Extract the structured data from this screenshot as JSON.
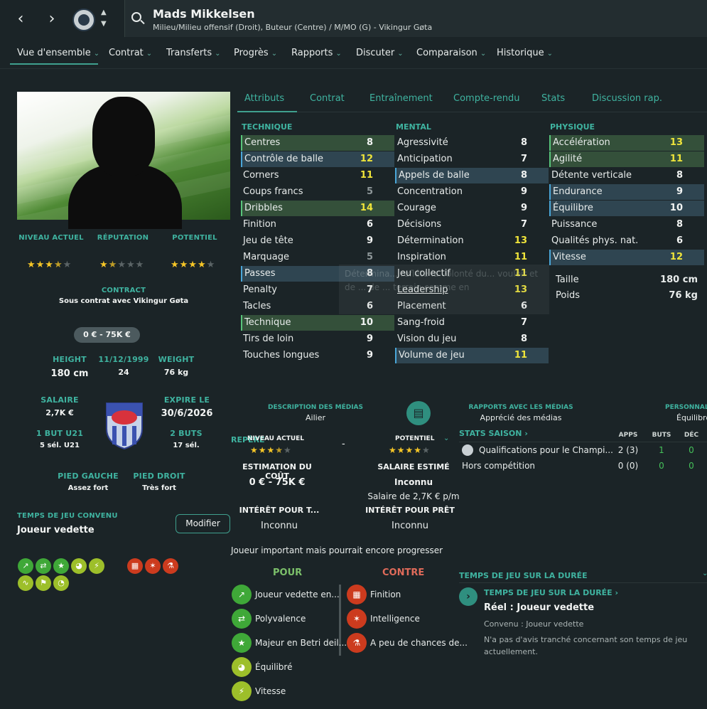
{
  "header": {
    "player_name": "Mads Mikkelsen",
    "player_subtitle": "Milieu/Milieu offensif (Droit), Buteur (Centre) / M/MO (G) - Vikingur Gøta",
    "back_icon": "chevron-left-icon",
    "forward_icon": "chevron-right-icon"
  },
  "nav_tabs": [
    {
      "label": "Vue d'ensemble",
      "active": true
    },
    {
      "label": "Contrat"
    },
    {
      "label": "Transferts"
    },
    {
      "label": "Progrès"
    },
    {
      "label": "Rapports"
    },
    {
      "label": "Discuter"
    },
    {
      "label": "Comparaison"
    },
    {
      "label": "Historique"
    }
  ],
  "profile": {
    "niveau_actuel_label": "NIVEAU ACTUEL",
    "reputation_label": "RÉPUTATION",
    "potentiel_label": "POTENTIEL",
    "niveau_actuel_stars": 3.5,
    "reputation_stars": 1.5,
    "potentiel_stars": 4,
    "contract_label": "CONTRACT",
    "contract_value": "Sous contrat avec Vikingur Gøta",
    "value_range": "0 € - 75K €",
    "height_label": "HEIGHT",
    "height_value": "180 cm",
    "dob_label": "11/12/1999",
    "age_value": "24",
    "weight_label": "WEIGHT",
    "weight_value": "76 kg",
    "salaire_label": "SALAIRE",
    "salaire_value": "2,7K €",
    "expire_label": "EXPIRE LE",
    "expire_value": "30/6/2026",
    "u21_label": "1 BUT U21",
    "u21_value": "5 sél. U21",
    "buts_label": "2 BUTS",
    "buts_value": "17 sél.",
    "pied_gauche_label": "PIED GAUCHE",
    "pied_gauche_value": "Assez fort",
    "pied_droit_label": "PIED DROIT",
    "pied_droit_value": "Très fort",
    "temps_label": "TEMPS DE JEU CONVENU",
    "temps_value": "Joueur vedette",
    "modifier_label": "Modifier"
  },
  "sub_tabs": [
    "Attributs",
    "Contrat",
    "Entraînement",
    "Compte-rendu",
    "Stats",
    "Discussion rap."
  ],
  "attributes": {
    "technique_title": "TECHNIQUE",
    "mental_title": "MENTAL",
    "physique_title": "PHYSIQUE",
    "technique": [
      {
        "name": "Centres",
        "value": "8",
        "hl": "green",
        "color": "white"
      },
      {
        "name": "Contrôle de balle",
        "value": "12",
        "hl": "blue",
        "color": "yellow"
      },
      {
        "name": "Corners",
        "value": "11",
        "hl": "",
        "color": "yellow"
      },
      {
        "name": "Coups francs",
        "value": "5",
        "hl": "",
        "color": "grey"
      },
      {
        "name": "Dribbles",
        "value": "14",
        "hl": "green",
        "color": "yellow"
      },
      {
        "name": "Finition",
        "value": "6",
        "hl": "",
        "color": "white"
      },
      {
        "name": "Jeu de tête",
        "value": "9",
        "hl": "",
        "color": "white"
      },
      {
        "name": "Marquage",
        "value": "5",
        "hl": "",
        "color": "grey"
      },
      {
        "name": "Passes",
        "value": "8",
        "hl": "blue",
        "color": "white"
      },
      {
        "name": "Penalty",
        "value": "7",
        "hl": "",
        "color": "white"
      },
      {
        "name": "Tacles",
        "value": "6",
        "hl": "",
        "color": "white"
      },
      {
        "name": "Technique",
        "value": "10",
        "hl": "green",
        "color": "white"
      },
      {
        "name": "Tirs de loin",
        "value": "9",
        "hl": "",
        "color": "white"
      },
      {
        "name": "Touches longues",
        "value": "9",
        "hl": "",
        "color": "white"
      }
    ],
    "mental": [
      {
        "name": "Agressivité",
        "value": "8",
        "hl": "",
        "color": "white"
      },
      {
        "name": "Anticipation",
        "value": "7",
        "hl": "",
        "color": "white"
      },
      {
        "name": "Appels de balle",
        "value": "8",
        "hl": "blue",
        "color": "white"
      },
      {
        "name": "Concentration",
        "value": "9",
        "hl": "",
        "color": "white"
      },
      {
        "name": "Courage",
        "value": "9",
        "hl": "",
        "color": "white"
      },
      {
        "name": "Décisions",
        "value": "7",
        "hl": "",
        "color": "white"
      },
      {
        "name": "Détermination",
        "value": "13",
        "hl": "",
        "color": "yellow"
      },
      {
        "name": "Inspiration",
        "value": "11",
        "hl": "",
        "color": "yellow"
      },
      {
        "name": "Jeu collectif",
        "value": "11",
        "hl": "",
        "color": "yellow"
      },
      {
        "name": "Leadership",
        "value": "13",
        "hl": "",
        "color": "yellow",
        "underline": true
      },
      {
        "name": "Placement",
        "value": "6",
        "hl": "",
        "color": "white"
      },
      {
        "name": "Sang-froid",
        "value": "7",
        "hl": "",
        "color": "white"
      },
      {
        "name": "Vision du jeu",
        "value": "8",
        "hl": "",
        "color": "white"
      },
      {
        "name": "Volume de jeu",
        "value": "11",
        "hl": "blue",
        "color": "yellow"
      }
    ],
    "physique": [
      {
        "name": "Accélération",
        "value": "13",
        "hl": "green",
        "color": "yellow"
      },
      {
        "name": "Agilité",
        "value": "11",
        "hl": "green",
        "color": "yellow"
      },
      {
        "name": "Détente verticale",
        "value": "8",
        "hl": "",
        "color": "white"
      },
      {
        "name": "Endurance",
        "value": "9",
        "hl": "blue",
        "color": "white"
      },
      {
        "name": "Équilibre",
        "value": "10",
        "hl": "blue",
        "color": "white"
      },
      {
        "name": "Puissance",
        "value": "8",
        "hl": "",
        "color": "white"
      },
      {
        "name": "Qualités phys. nat.",
        "value": "6",
        "hl": "",
        "color": "white"
      },
      {
        "name": "Vitesse",
        "value": "12",
        "hl": "blue",
        "color": "yellow"
      }
    ],
    "taille_label": "Taille",
    "taille_value": "180 cm",
    "poids_label": "Poids",
    "poids_value": "76 kg"
  },
  "overlay_tooltip": "Détermina... refléte la volonté du... vouloir et de ... de ... terrain comme en",
  "media": {
    "desc_label": "DESCRIPTION DES MÉDIAS",
    "desc_value": "Ailier",
    "rapports_label": "RAPPORTS AVEC LES MÉDIAS",
    "rapports_value": "Apprécié des médias",
    "perso_label": "PERSONNAL",
    "perso_value": "Équilibré"
  },
  "report": {
    "repere_label": "REPÈRE",
    "niveau_label": "NIVEAU ACTUEL",
    "potentiel_label": "POTENTIEL",
    "dash": "-",
    "estimation_label": "ESTIMATION DU COÛT",
    "estimation_value": "0 € - 75K €",
    "salaire_est_label": "SALAIRE ESTIMÉ",
    "salaire_est_value": "Inconnu",
    "salaire_pm": "Salaire de 2,7K € p/m",
    "interet_transfert_label": "INTÉRÊT POUR T...",
    "interet_transfert_value": "Inconnu",
    "interet_pret_label": "INTÉRÊT POUR PRÊT",
    "interet_pret_value": "Inconnu",
    "summary": "Joueur important mais pourrait encore progresser",
    "pour_label": "POUR",
    "contre_label": "CONTRE",
    "pour": [
      "Joueur vedette en...",
      "Polyvalence",
      "Majeur en Betri deil...",
      "Équilibré",
      "Vitesse"
    ],
    "contre": [
      "Finition",
      "Intelligence",
      "A peu de chances de..."
    ]
  },
  "stats": {
    "title": "STATS SAISON",
    "col_apps": "APPS",
    "col_buts": "BUTS",
    "col_dec": "DÉC",
    "rows": [
      {
        "name": "Qualifications pour le Champi...",
        "apps": "2 (3)",
        "buts": "1",
        "dec": "0"
      },
      {
        "name": "Hors compétition",
        "apps": "0 (0)",
        "buts": "0",
        "dec": "0"
      }
    ]
  },
  "playtime": {
    "section_title": "TEMPS DE JEU SUR LA DURÉE",
    "link_title": "TEMPS DE JEU SUR LA DURÉE",
    "reel": "Réel : Joueur vedette",
    "convenu": "Convenu : Joueur vedette",
    "note": "N'a pas d'avis tranché concernant son temps de jeu actuellement."
  }
}
